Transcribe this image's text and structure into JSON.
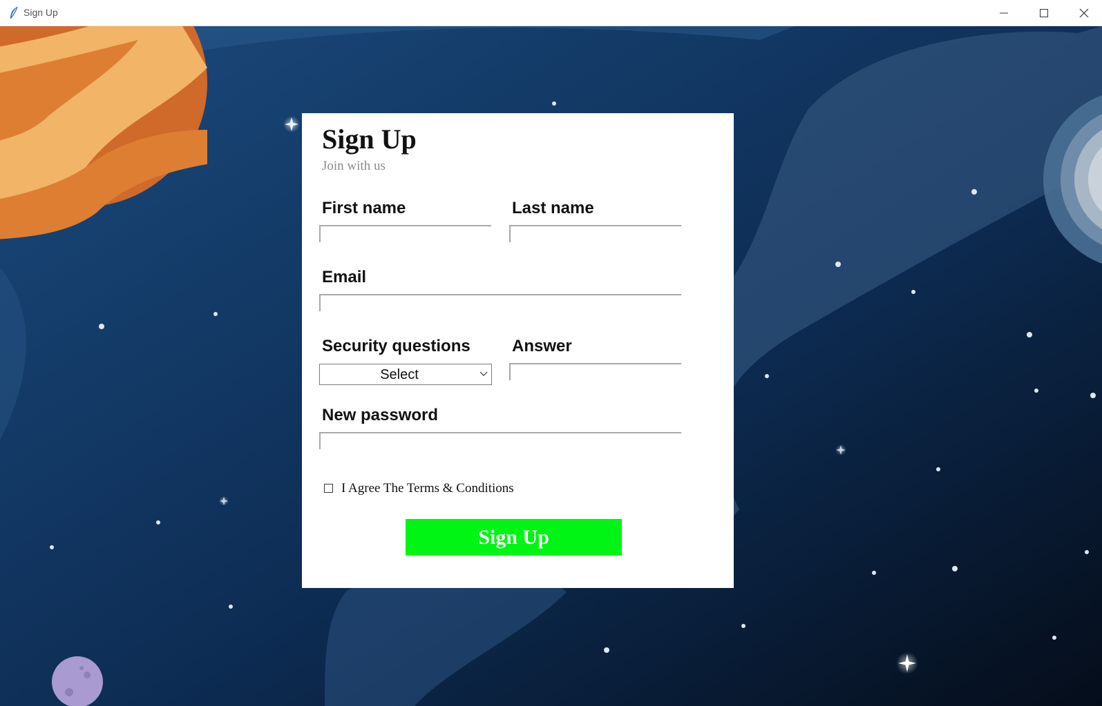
{
  "window": {
    "title": "Sign Up",
    "app_icon": "feather-icon",
    "controls": [
      "minimize-icon",
      "maximize-icon",
      "close-icon"
    ]
  },
  "form": {
    "title": "Sign Up",
    "subtitle": "Join with us",
    "first_name": {
      "label": "First name",
      "value": ""
    },
    "last_name": {
      "label": "Last name",
      "value": ""
    },
    "email": {
      "label": "Email",
      "value": ""
    },
    "security_question": {
      "label": "Security questions",
      "selected": "Select"
    },
    "answer": {
      "label": "Answer",
      "value": ""
    },
    "new_password": {
      "label": "New password",
      "value": ""
    },
    "terms": {
      "label": "I Agree The Terms & Conditions",
      "checked": false
    },
    "submit_label": "Sign Up"
  },
  "colors": {
    "background_deep": "#0a1f3d",
    "planet_orange": "#e07a2e",
    "submit_green": "#00f514",
    "subtitle_gray": "#8a8a8a"
  }
}
